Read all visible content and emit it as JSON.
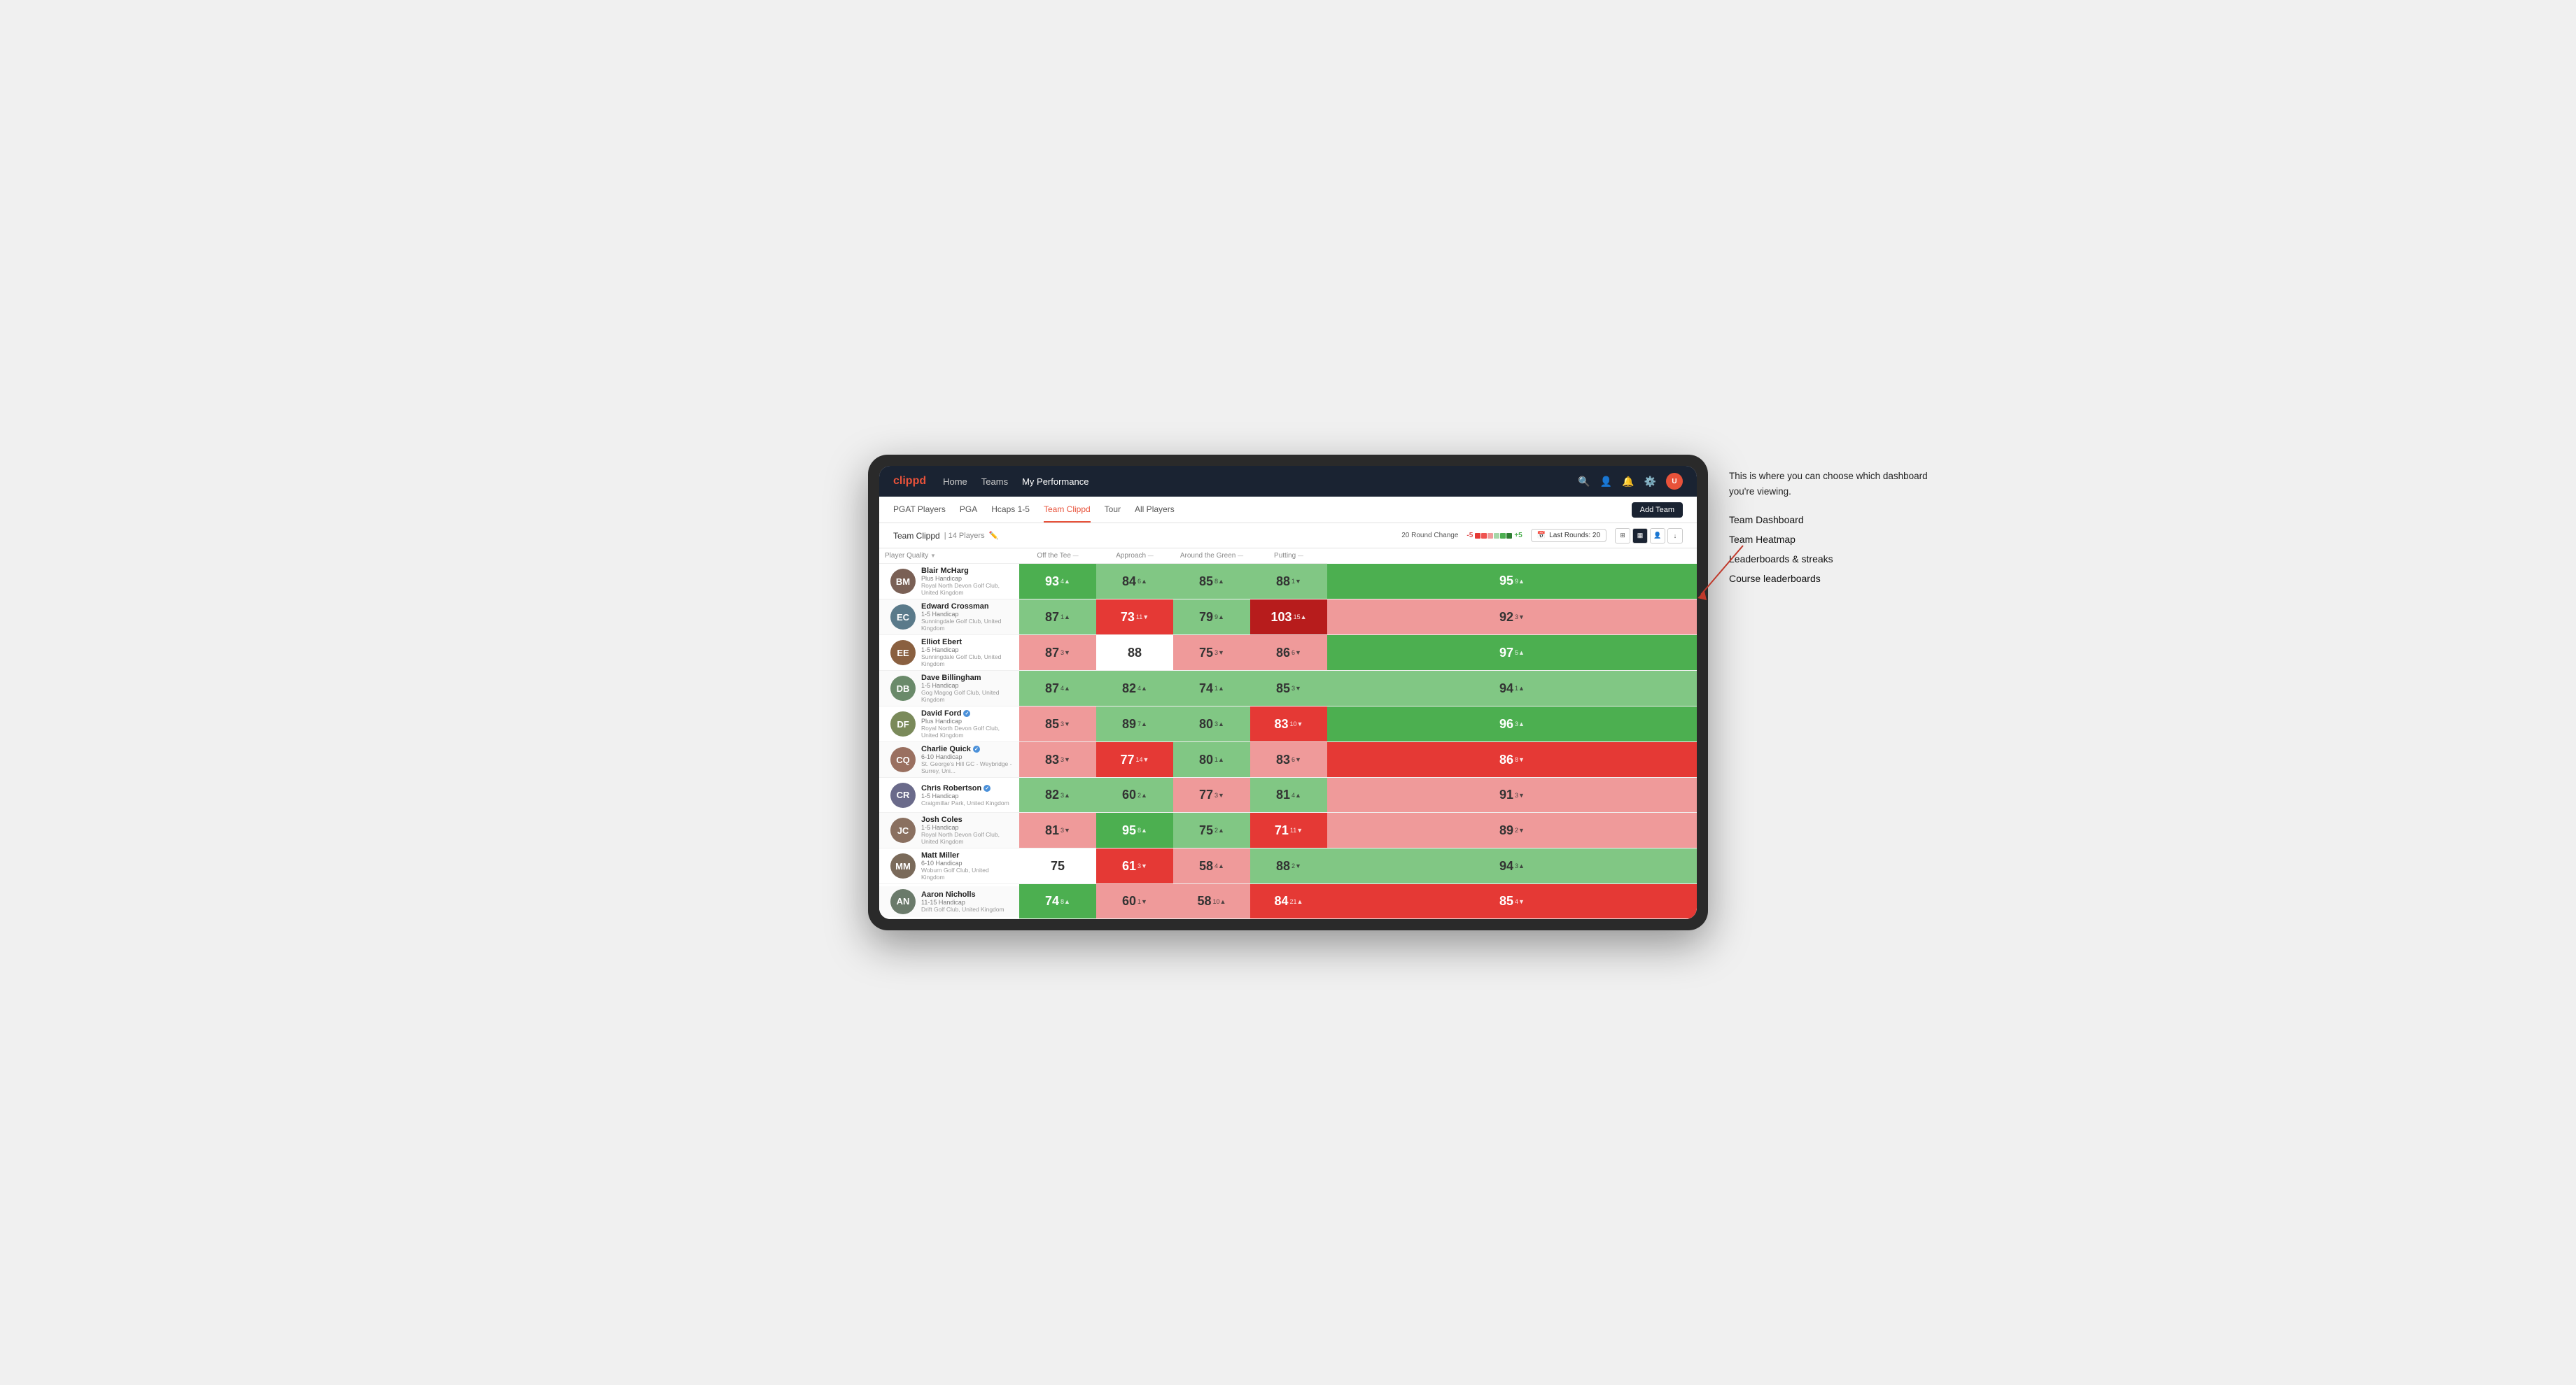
{
  "nav": {
    "logo": "clippd",
    "links": [
      {
        "label": "Home",
        "active": false
      },
      {
        "label": "Teams",
        "active": false
      },
      {
        "label": "My Performance",
        "active": true
      }
    ],
    "icons": [
      "search",
      "user",
      "bell",
      "settings",
      "avatar"
    ]
  },
  "sub_nav": {
    "links": [
      {
        "label": "PGAT Players",
        "active": false
      },
      {
        "label": "PGA",
        "active": false
      },
      {
        "label": "Hcaps 1-5",
        "active": false
      },
      {
        "label": "Team Clippd",
        "active": true
      },
      {
        "label": "Tour",
        "active": false
      },
      {
        "label": "All Players",
        "active": false
      }
    ],
    "add_team_label": "Add Team"
  },
  "team_header": {
    "name": "Team Clippd",
    "separator": "|",
    "player_count": "14 Players",
    "round_change_label": "20 Round Change",
    "neg_value": "-5",
    "pos_value": "+5",
    "last_rounds_label": "Last Rounds:",
    "last_rounds_value": "20"
  },
  "columns": {
    "player_quality": "Player Quality",
    "off_tee": "Off the Tee",
    "approach": "Approach",
    "around_green": "Around the Green",
    "putting": "Putting"
  },
  "players": [
    {
      "name": "Blair McHarg",
      "handicap": "Plus Handicap",
      "club": "Royal North Devon Golf Club, United Kingdom",
      "initials": "BM",
      "avatar_color": "#7a6055",
      "scores": [
        {
          "value": "93",
          "change": "4",
          "dir": "up",
          "bg": "green-mid"
        },
        {
          "value": "84",
          "change": "6",
          "dir": "up",
          "bg": "green-light"
        },
        {
          "value": "85",
          "change": "8",
          "dir": "up",
          "bg": "green-light"
        },
        {
          "value": "88",
          "change": "1",
          "dir": "down",
          "bg": "green-light"
        },
        {
          "value": "95",
          "change": "9",
          "dir": "up",
          "bg": "green-mid"
        }
      ]
    },
    {
      "name": "Edward Crossman",
      "handicap": "1-5 Handicap",
      "club": "Sunningdale Golf Club, United Kingdom",
      "initials": "EC",
      "avatar_color": "#5a7a8a",
      "scores": [
        {
          "value": "87",
          "change": "1",
          "dir": "up",
          "bg": "green-light"
        },
        {
          "value": "73",
          "change": "11",
          "dir": "down",
          "bg": "red-mid"
        },
        {
          "value": "79",
          "change": "9",
          "dir": "up",
          "bg": "green-light"
        },
        {
          "value": "103",
          "change": "15",
          "dir": "up",
          "bg": "red-dark"
        },
        {
          "value": "92",
          "change": "3",
          "dir": "down",
          "bg": "red-light"
        }
      ]
    },
    {
      "name": "Elliot Ebert",
      "handicap": "1-5 Handicap",
      "club": "Sunningdale Golf Club, United Kingdom",
      "initials": "EE",
      "avatar_color": "#8a6040",
      "scores": [
        {
          "value": "87",
          "change": "3",
          "dir": "down",
          "bg": "red-light"
        },
        {
          "value": "88",
          "change": "",
          "dir": "none",
          "bg": "neutral"
        },
        {
          "value": "75",
          "change": "3",
          "dir": "down",
          "bg": "red-light"
        },
        {
          "value": "86",
          "change": "6",
          "dir": "down",
          "bg": "red-light"
        },
        {
          "value": "97",
          "change": "5",
          "dir": "up",
          "bg": "green-mid"
        }
      ]
    },
    {
      "name": "Dave Billingham",
      "handicap": "1-5 Handicap",
      "club": "Gog Magog Golf Club, United Kingdom",
      "initials": "DB",
      "avatar_color": "#6a8a6a",
      "scores": [
        {
          "value": "87",
          "change": "4",
          "dir": "up",
          "bg": "green-light"
        },
        {
          "value": "82",
          "change": "4",
          "dir": "up",
          "bg": "green-light"
        },
        {
          "value": "74",
          "change": "1",
          "dir": "up",
          "bg": "green-light"
        },
        {
          "value": "85",
          "change": "3",
          "dir": "down",
          "bg": "green-light"
        },
        {
          "value": "94",
          "change": "1",
          "dir": "up",
          "bg": "green-light"
        }
      ]
    },
    {
      "name": "David Ford",
      "handicap": "Plus Handicap",
      "club": "Royal North Devon Golf Club, United Kingdom",
      "initials": "DF",
      "avatar_color": "#7a8a5a",
      "verified": true,
      "scores": [
        {
          "value": "85",
          "change": "3",
          "dir": "down",
          "bg": "red-light"
        },
        {
          "value": "89",
          "change": "7",
          "dir": "up",
          "bg": "green-light"
        },
        {
          "value": "80",
          "change": "3",
          "dir": "up",
          "bg": "green-light"
        },
        {
          "value": "83",
          "change": "10",
          "dir": "down",
          "bg": "red-mid"
        },
        {
          "value": "96",
          "change": "3",
          "dir": "up",
          "bg": "green-mid"
        }
      ]
    },
    {
      "name": "Charlie Quick",
      "handicap": "6-10 Handicap",
      "club": "St. George's Hill GC - Weybridge - Surrey, Uni...",
      "initials": "CQ",
      "avatar_color": "#9a7060",
      "verified": true,
      "scores": [
        {
          "value": "83",
          "change": "3",
          "dir": "down",
          "bg": "red-light"
        },
        {
          "value": "77",
          "change": "14",
          "dir": "down",
          "bg": "red-mid"
        },
        {
          "value": "80",
          "change": "1",
          "dir": "up",
          "bg": "green-light"
        },
        {
          "value": "83",
          "change": "6",
          "dir": "down",
          "bg": "red-light"
        },
        {
          "value": "86",
          "change": "8",
          "dir": "down",
          "bg": "red-mid"
        }
      ]
    },
    {
      "name": "Chris Robertson",
      "handicap": "1-5 Handicap",
      "club": "Craigmillar Park, United Kingdom",
      "initials": "CR",
      "avatar_color": "#6a6a8a",
      "verified": true,
      "scores": [
        {
          "value": "82",
          "change": "3",
          "dir": "up",
          "bg": "green-light"
        },
        {
          "value": "60",
          "change": "2",
          "dir": "up",
          "bg": "green-light"
        },
        {
          "value": "77",
          "change": "3",
          "dir": "down",
          "bg": "red-light"
        },
        {
          "value": "81",
          "change": "4",
          "dir": "up",
          "bg": "green-light"
        },
        {
          "value": "91",
          "change": "3",
          "dir": "down",
          "bg": "red-light"
        }
      ]
    },
    {
      "name": "Josh Coles",
      "handicap": "1-5 Handicap",
      "club": "Royal North Devon Golf Club, United Kingdom",
      "initials": "JC",
      "avatar_color": "#8a7060",
      "scores": [
        {
          "value": "81",
          "change": "3",
          "dir": "down",
          "bg": "red-light"
        },
        {
          "value": "95",
          "change": "8",
          "dir": "up",
          "bg": "green-mid"
        },
        {
          "value": "75",
          "change": "2",
          "dir": "up",
          "bg": "green-light"
        },
        {
          "value": "71",
          "change": "11",
          "dir": "down",
          "bg": "red-mid"
        },
        {
          "value": "89",
          "change": "2",
          "dir": "down",
          "bg": "red-light"
        }
      ]
    },
    {
      "name": "Matt Miller",
      "handicap": "6-10 Handicap",
      "club": "Woburn Golf Club, United Kingdom",
      "initials": "MM",
      "avatar_color": "#7a6a5a",
      "scores": [
        {
          "value": "75",
          "change": "",
          "dir": "none",
          "bg": "neutral"
        },
        {
          "value": "61",
          "change": "3",
          "dir": "down",
          "bg": "red-mid"
        },
        {
          "value": "58",
          "change": "4",
          "dir": "up",
          "bg": "red-light"
        },
        {
          "value": "88",
          "change": "2",
          "dir": "down",
          "bg": "green-light"
        },
        {
          "value": "94",
          "change": "3",
          "dir": "up",
          "bg": "green-light"
        }
      ]
    },
    {
      "name": "Aaron Nicholls",
      "handicap": "11-15 Handicap",
      "club": "Drift Golf Club, United Kingdom",
      "initials": "AN",
      "avatar_color": "#6a7a6a",
      "scores": [
        {
          "value": "74",
          "change": "8",
          "dir": "up",
          "bg": "green-mid"
        },
        {
          "value": "60",
          "change": "1",
          "dir": "down",
          "bg": "red-light"
        },
        {
          "value": "58",
          "change": "10",
          "dir": "up",
          "bg": "red-light"
        },
        {
          "value": "84",
          "change": "21",
          "dir": "up",
          "bg": "red-mid"
        },
        {
          "value": "85",
          "change": "4",
          "dir": "down",
          "bg": "red-mid"
        }
      ]
    }
  ],
  "annotation": {
    "intro": "This is where you can choose which dashboard you're viewing.",
    "items": [
      "Team Dashboard",
      "Team Heatmap",
      "Leaderboards & streaks",
      "Course leaderboards"
    ]
  }
}
